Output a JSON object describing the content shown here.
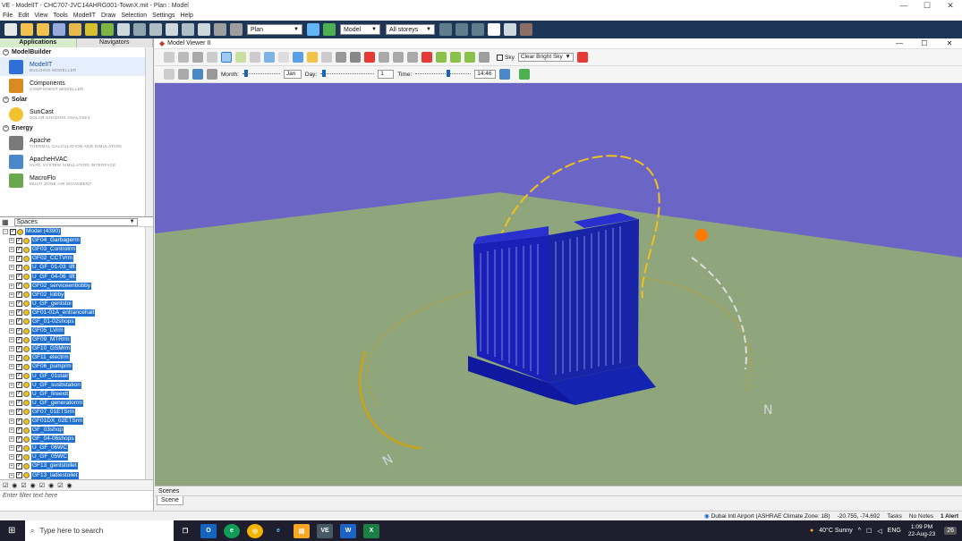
{
  "window": {
    "title": "VE - ModelIT - CHC707-JVC14AHRG001-TownX.mit - Plan : Model",
    "controls": [
      "—",
      "☐",
      "✕"
    ]
  },
  "menu": [
    "File",
    "Edit",
    "View",
    "Tools",
    "ModelIT",
    "Draw",
    "Selection",
    "Settings",
    "Help"
  ],
  "toolbar": {
    "view_select": "Plan",
    "model_select": "Model",
    "storey_select": "All storeys",
    "colors": {
      "bg": "#1d3557"
    }
  },
  "left_tabs": {
    "applications": "Applications",
    "navigators": "Navigators"
  },
  "modules": [
    {
      "group": "ModelBuilder",
      "items": [
        {
          "name": "ModelIT",
          "sub": "BUILDING MODELLER",
          "selected": true,
          "color": "#2f6fd6"
        },
        {
          "name": "Components",
          "sub": "COMPONENT MODELLER",
          "selected": false,
          "color": "#d98b1f"
        }
      ]
    },
    {
      "group": "Solar",
      "items": [
        {
          "name": "SunCast",
          "sub": "SOLAR SHADING ANALYSES",
          "selected": false,
          "color": "#f2c230"
        }
      ]
    },
    {
      "group": "Energy",
      "items": [
        {
          "name": "Apache",
          "sub": "THERMAL CALCULATION AND SIMULATION",
          "selected": false,
          "color": "#7a7a7a"
        },
        {
          "name": "ApacheHVAC",
          "sub": "HVAC SYSTEM SIMULATION INTERFACE",
          "selected": false,
          "color": "#4a88c8"
        },
        {
          "name": "MacroFlo",
          "sub": "MULTI ZONE AIR MOVEMENT",
          "selected": false,
          "color": "#6aa84f"
        }
      ]
    }
  ],
  "spaces": {
    "dropdown": "Spaces",
    "root": "Model (4390)",
    "items": [
      "GF04_Garbagerm",
      "GF03_Controlrm",
      "GF02_CCTVrm",
      "U_GF_01-03_lift",
      "U_GF_04-06_lift",
      "GF02_serviceentlobby",
      "GF02_lobby",
      "U_GF_gentstoi",
      "GF01-01A_entrancehall",
      "GF_01-02shops",
      "GF05_LVrm",
      "GF09_MTRrm",
      "GF10_GSMrm",
      "GF11_electrm",
      "GF06_pumprm",
      "U_GF_01stair",
      "U_GF_susbstation",
      "U_GF_fireexit",
      "U_GF_generatorrm",
      "GF07_01ETSrm",
      "GF01DX_02ETSrm",
      "GF_03shop",
      "GF_04-06shops",
      "U_GF_06WC",
      "U_GF_05WC",
      "GF13_gentstoilet",
      "GF13_ladiestoilet"
    ],
    "filter_placeholder": "Enter filter text here"
  },
  "viewer": {
    "title": "Model Viewer II",
    "sky_label": "Sky",
    "sky_select": "Clear Bright Sky",
    "month_label": "Month:",
    "month_value": "Jan",
    "day_label": "Day:",
    "day_value": "1",
    "time_label": "Time:",
    "time_value": "14:46",
    "month_slider": 0.05,
    "day_slider": 0.03,
    "time_slider": 0.6,
    "colors": {
      "sky": "#6b66c6",
      "ground": "#8fa57c",
      "building": "#1a1fb8",
      "sunpath": "#f2c01a",
      "sun": "#ff7a00"
    }
  },
  "scenes": {
    "header": "Scenes",
    "tab": "Scene"
  },
  "status": {
    "location": "Dubai Intl Airport (ASHRAE Climate Zone: 1B)",
    "coords": "-20.755, -74.692",
    "tasks": "Tasks",
    "notes": "No Notes",
    "alert": "1 Alert"
  },
  "taskbar": {
    "search_placeholder": "Type here to search",
    "weather": "40°C  Sunny",
    "lang": "ENG",
    "time": "1:09 PM",
    "date": "22-Aug-23",
    "badge": "26"
  }
}
